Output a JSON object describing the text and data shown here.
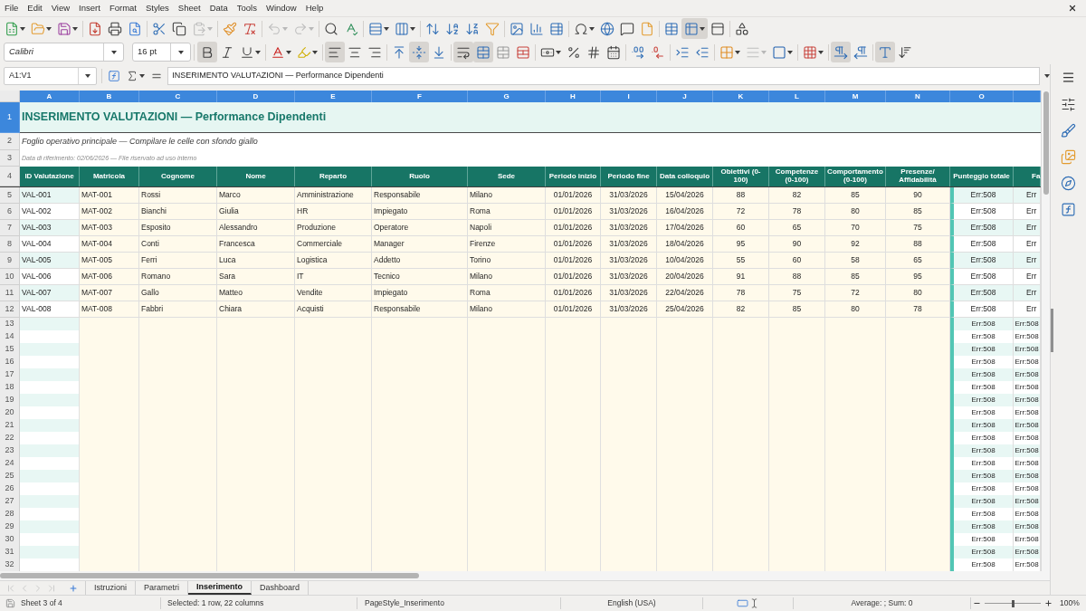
{
  "menu_bar": [
    "File",
    "Edit",
    "View",
    "Insert",
    "Format",
    "Styles",
    "Sheet",
    "Data",
    "Tools",
    "Window",
    "Help"
  ],
  "standard_toolbar": {
    "paste_disabled": true,
    "undo_disabled": true,
    "redo_disabled": true,
    "freeze_rows_active": true
  },
  "formatting_toolbar": {
    "font_name": "Calibri",
    "font_size": "16 pt",
    "bold": true,
    "italic": false,
    "underline": false,
    "align_left": true,
    "align_center": false,
    "align_right": false,
    "align_top": false,
    "align_middle": true,
    "align_bottom": false,
    "wrap_text": true,
    "merge_and_center": true,
    "border_style_disabled": true,
    "left_to_right": true,
    "right_to_left": false,
    "horizontal_text": true,
    "vertical_text": false
  },
  "formula_bar": {
    "name_box": "A1:V1",
    "content": "INSERIMENTO VALUTAZIONI — Performance Dipendenti"
  },
  "sheet": {
    "columns": [
      {
        "label": "A",
        "selected": true
      },
      {
        "label": "B",
        "selected": true
      },
      {
        "label": "C",
        "selected": true
      },
      {
        "label": "D",
        "selected": true
      },
      {
        "label": "E",
        "selected": true
      },
      {
        "label": "F",
        "selected": true
      },
      {
        "label": "G",
        "selected": true
      },
      {
        "label": "H",
        "selected": true
      },
      {
        "label": "I",
        "selected": true
      },
      {
        "label": "J",
        "selected": true
      },
      {
        "label": "K",
        "selected": true
      },
      {
        "label": "L",
        "selected": true
      },
      {
        "label": "M",
        "selected": true
      },
      {
        "label": "N",
        "selected": true
      },
      {
        "label": "O",
        "selected": true
      },
      {
        "selected": true
      }
    ],
    "rows": [
      {
        "number": "1",
        "selected": true,
        "kind": "title",
        "text": "INSERIMENTO VALUTAZIONI — Performance Dipendenti"
      },
      {
        "number": "2",
        "selected": false,
        "kind": "subtitle",
        "text": "Foglio operativo principale — Compilare le celle con sfondo giallo"
      },
      {
        "number": "3",
        "selected": false,
        "kind": "note",
        "text": "Data di riferimento: 02/06/2026 — File riservato ad uso interno"
      },
      {
        "number": "4",
        "selected": false,
        "kind": "header",
        "cells": [
          "ID Valutazione",
          "Matricola",
          "Cognome",
          "Nome",
          "Reparto",
          "Ruolo",
          "Sede",
          "Periodo inizio",
          "Periodo fine",
          "Data colloquio",
          "Obiettivi (0-100)",
          "Competenze (0-100)",
          "Comportamento (0-100)",
          "Presenze/ Affidabilità",
          "Punteggio totale",
          "Fa"
        ]
      },
      {
        "number": "5",
        "selected": false,
        "kind": "data",
        "cells": [
          "VAL-001",
          "MAT-001",
          "Rossi",
          "Marco",
          "Amministrazione",
          "Responsabile",
          "Milano",
          "01/01/2026",
          "31/03/2026",
          "15/04/2026",
          "88",
          "82",
          "85",
          "90",
          "Err:508",
          "Err"
        ]
      },
      {
        "number": "6",
        "selected": false,
        "kind": "data",
        "cells": [
          "VAL-002",
          "MAT-002",
          "Bianchi",
          "Giulia",
          "HR",
          "Impiegato",
          "Roma",
          "01/01/2026",
          "31/03/2026",
          "16/04/2026",
          "72",
          "78",
          "80",
          "85",
          "Err:508",
          "Err"
        ]
      },
      {
        "number": "7",
        "selected": false,
        "kind": "data",
        "cells": [
          "VAL-003",
          "MAT-003",
          "Esposito",
          "Alessandro",
          "Produzione",
          "Operatore",
          "Napoli",
          "01/01/2026",
          "31/03/2026",
          "17/04/2026",
          "60",
          "65",
          "70",
          "75",
          "Err:508",
          "Err"
        ]
      },
      {
        "number": "8",
        "selected": false,
        "kind": "data",
        "cells": [
          "VAL-004",
          "MAT-004",
          "Conti",
          "Francesca",
          "Commerciale",
          "Manager",
          "Firenze",
          "01/01/2026",
          "31/03/2026",
          "18/04/2026",
          "95",
          "90",
          "92",
          "88",
          "Err:508",
          "Err"
        ]
      },
      {
        "number": "9",
        "selected": false,
        "kind": "data",
        "cells": [
          "VAL-005",
          "MAT-005",
          "Ferri",
          "Luca",
          "Logistica",
          "Addetto",
          "Torino",
          "01/01/2026",
          "31/03/2026",
          "10/04/2026",
          "55",
          "60",
          "58",
          "65",
          "Err:508",
          "Err"
        ]
      },
      {
        "number": "10",
        "selected": false,
        "kind": "data",
        "cells": [
          "VAL-006",
          "MAT-006",
          "Romano",
          "Sara",
          "IT",
          "Tecnico",
          "Milano",
          "01/01/2026",
          "31/03/2026",
          "20/04/2026",
          "91",
          "88",
          "85",
          "95",
          "Err:508",
          "Err"
        ]
      },
      {
        "number": "11",
        "selected": false,
        "kind": "data",
        "cells": [
          "VAL-007",
          "MAT-007",
          "Gallo",
          "Matteo",
          "Vendite",
          "Impiegato",
          "Roma",
          "01/01/2026",
          "31/03/2026",
          "22/04/2026",
          "78",
          "75",
          "72",
          "80",
          "Err:508",
          "Err"
        ]
      },
      {
        "number": "12",
        "selected": false,
        "kind": "data",
        "cells": [
          "VAL-008",
          "MAT-008",
          "Fabbri",
          "Chiara",
          "Acquisti",
          "Responsabile",
          "Milano",
          "01/01/2026",
          "31/03/2026",
          "25/04/2026",
          "82",
          "85",
          "80",
          "78",
          "Err:508",
          "Err"
        ]
      },
      {
        "number": "13",
        "selected": false,
        "kind": "blank",
        "trailing_cells": [
          "Err:508",
          "Err:508"
        ]
      },
      {
        "number": "14",
        "selected": false,
        "kind": "blank",
        "trailing_cells": [
          "Err:508",
          "Err:508"
        ]
      },
      {
        "number": "15",
        "selected": false,
        "kind": "blank",
        "trailing_cells": [
          "Err:508",
          "Err:508"
        ]
      },
      {
        "number": "16",
        "selected": false,
        "kind": "blank",
        "trailing_cells": [
          "Err:508",
          "Err:508"
        ]
      },
      {
        "number": "17",
        "selected": false,
        "kind": "blank",
        "trailing_cells": [
          "Err:508",
          "Err:508"
        ]
      },
      {
        "number": "18",
        "selected": false,
        "kind": "blank",
        "trailing_cells": [
          "Err:508",
          "Err:508"
        ]
      },
      {
        "number": "19",
        "selected": false,
        "kind": "blank",
        "trailing_cells": [
          "Err:508",
          "Err:508"
        ]
      },
      {
        "number": "20",
        "selected": false,
        "kind": "blank",
        "trailing_cells": [
          "Err:508",
          "Err:508"
        ]
      },
      {
        "number": "21",
        "selected": false,
        "kind": "blank",
        "trailing_cells": [
          "Err:508",
          "Err:508"
        ]
      },
      {
        "number": "22",
        "selected": false,
        "kind": "blank",
        "trailing_cells": [
          "Err:508",
          "Err:508"
        ]
      },
      {
        "number": "23",
        "selected": false,
        "kind": "blank",
        "trailing_cells": [
          "Err:508",
          "Err:508"
        ]
      },
      {
        "number": "24",
        "selected": false,
        "kind": "blank",
        "trailing_cells": [
          "Err:508",
          "Err:508"
        ]
      },
      {
        "number": "25",
        "selected": false,
        "kind": "blank",
        "trailing_cells": [
          "Err:508",
          "Err:508"
        ]
      },
      {
        "number": "26",
        "selected": false,
        "kind": "blank",
        "trailing_cells": [
          "Err:508",
          "Err:508"
        ]
      },
      {
        "number": "27",
        "selected": false,
        "kind": "blank",
        "trailing_cells": [
          "Err:508",
          "Err:508"
        ]
      },
      {
        "number": "28",
        "selected": false,
        "kind": "blank",
        "trailing_cells": [
          "Err:508",
          "Err:508"
        ]
      },
      {
        "number": "29",
        "selected": false,
        "kind": "blank",
        "trailing_cells": [
          "Err:508",
          "Err:508"
        ]
      },
      {
        "number": "30",
        "selected": false,
        "kind": "blank",
        "trailing_cells": [
          "Err:508",
          "Err:508"
        ]
      },
      {
        "number": "31",
        "selected": false,
        "kind": "blank",
        "trailing_cells": [
          "Err:508",
          "Err:508"
        ]
      },
      {
        "number": "32",
        "selected": false,
        "kind": "blank",
        "trailing_cells": [
          "Err:508",
          "Err:508"
        ]
      }
    ]
  },
  "sheet_tabs": [
    {
      "label": "Istruzioni",
      "selected": false
    },
    {
      "label": "Parametri",
      "selected": false
    },
    {
      "label": "Inserimento",
      "selected": true
    },
    {
      "label": "Dashboard",
      "selected": false
    }
  ],
  "status_bar": {
    "sheet": "Sheet 3 of 4",
    "selection": "Selected: 1 row, 22 columns",
    "page_style": "PageStyle_Inserimento",
    "language": "English (USA)",
    "summary": "Average: ; Sum: 0",
    "zoom": {
      "level": 0.5,
      "reading": "100%"
    }
  }
}
